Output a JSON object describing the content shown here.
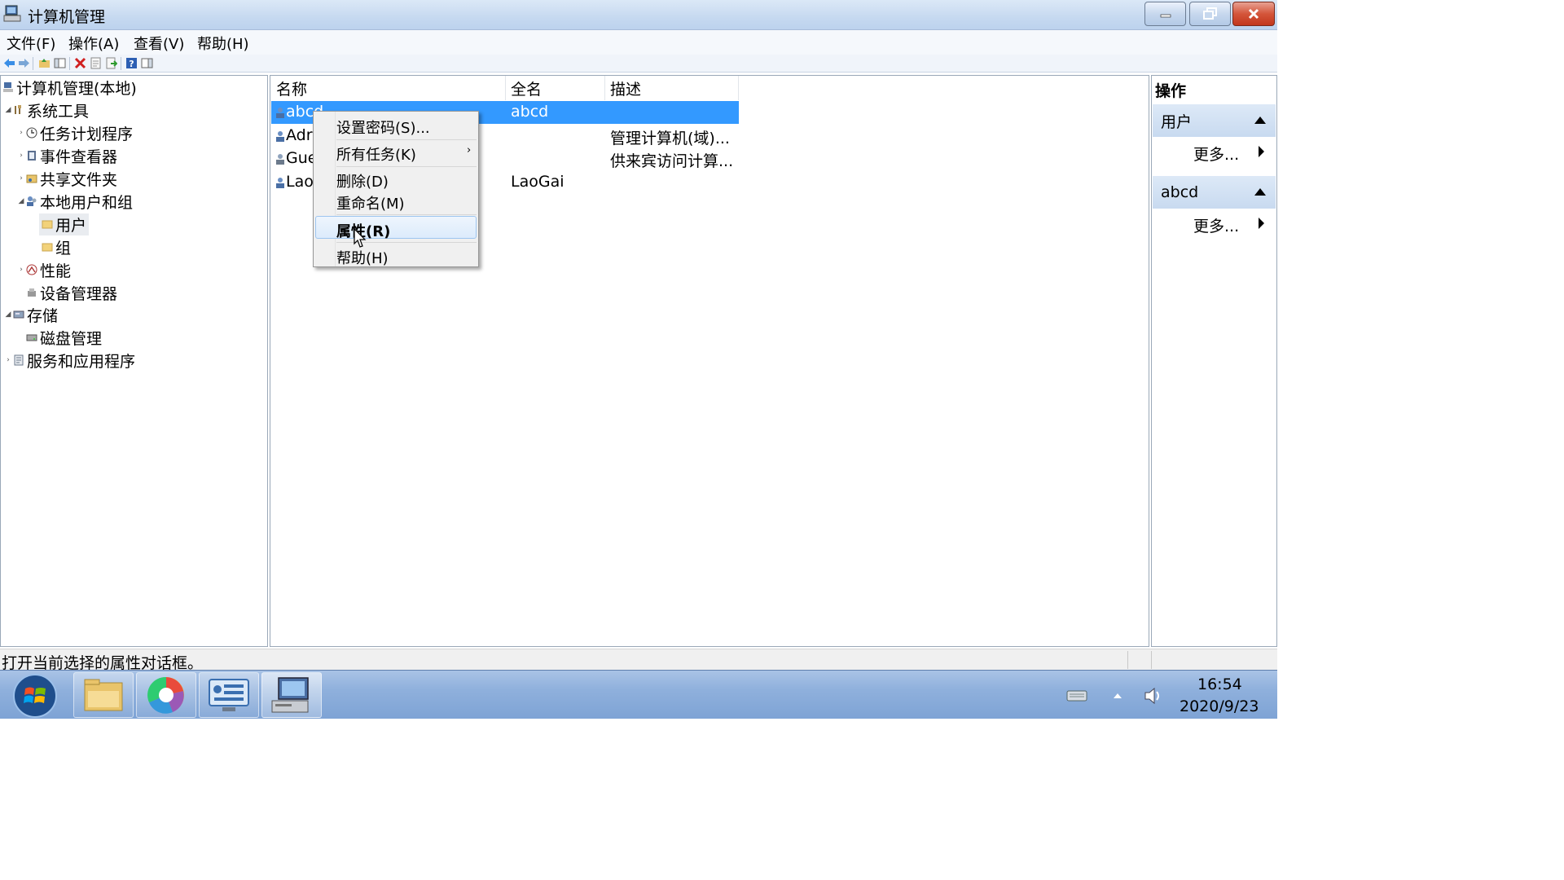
{
  "window": {
    "title": "计算机管理"
  },
  "menu": [
    "文件(F)",
    "操作(A)",
    "查看(V)",
    "帮助(H)"
  ],
  "tree": {
    "root": "计算机管理(本地)",
    "system_tools": "系统工具",
    "task_scheduler": "任务计划程序",
    "event_viewer": "事件查看器",
    "shared_folders": "共享文件夹",
    "local_users_groups": "本地用户和组",
    "users": "用户",
    "groups": "组",
    "performance": "性能",
    "device_manager": "设备管理器",
    "storage": "存储",
    "disk_management": "磁盘管理",
    "services_apps": "服务和应用程序"
  },
  "list": {
    "columns": [
      "名称",
      "全名",
      "描述"
    ],
    "rows": [
      {
        "name": "abcd",
        "fullname": "abcd",
        "desc": ""
      },
      {
        "name": "Adr",
        "fullname": "",
        "desc": "管理计算机(域)..."
      },
      {
        "name": "Gue",
        "fullname": "",
        "desc": "供来宾访问计算..."
      },
      {
        "name": "Lao",
        "fullname": "LaoGai",
        "desc": ""
      }
    ]
  },
  "context_menu": {
    "set_password": "设置密码(S)...",
    "all_tasks": "所有任务(K)",
    "delete": "删除(D)",
    "rename": "重命名(M)",
    "properties": "属性(R)",
    "help": "帮助(H)"
  },
  "actions": {
    "title": "操作",
    "group1": "用户",
    "more1": "更多...",
    "group2": "abcd",
    "more2": "更多..."
  },
  "status": {
    "text": "打开当前选择的属性对话框。"
  },
  "clock": {
    "time": "16:54",
    "date": "2020/9/23"
  }
}
